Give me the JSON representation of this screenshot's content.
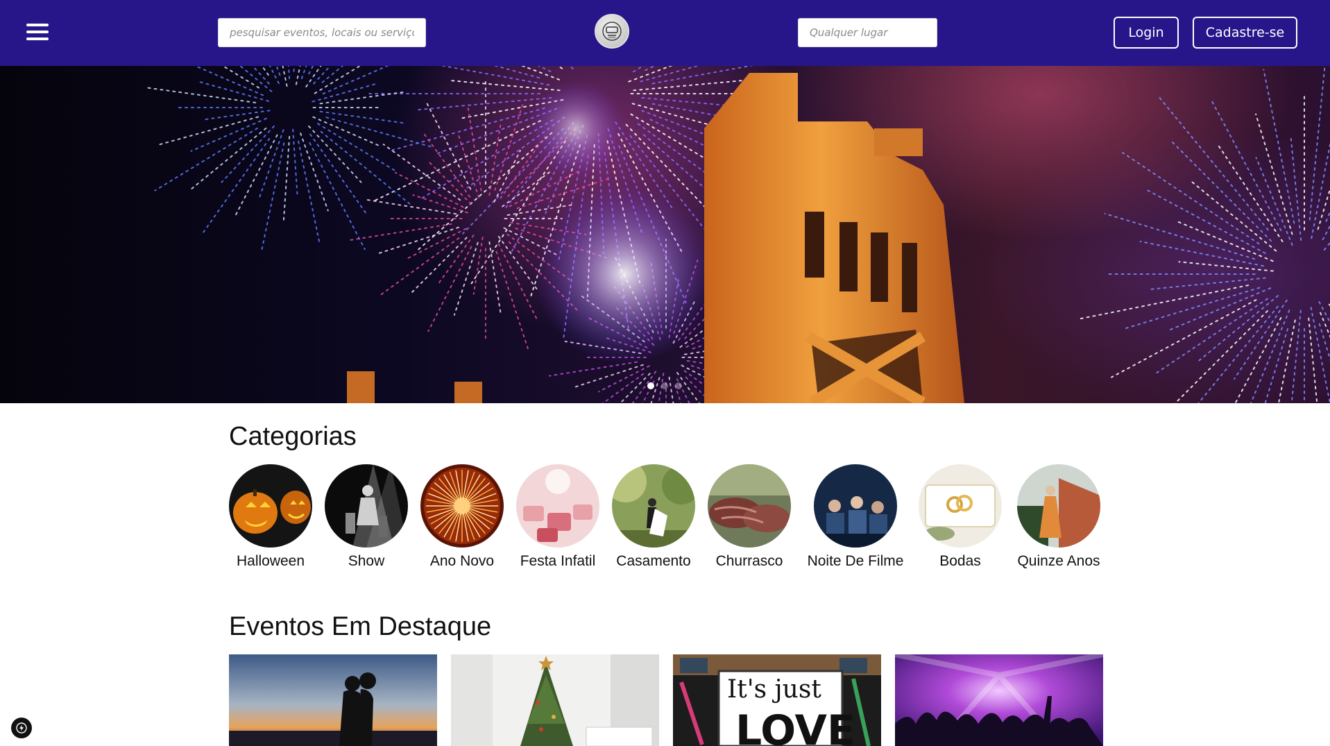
{
  "header": {
    "search_placeholder": "pesquisar eventos, locais ou serviços",
    "location_placeholder": "Qualquer lugar",
    "login_label": "Login",
    "signup_label": "Cadastre-se",
    "background_color": "#27168a"
  },
  "hero": {
    "active_slide": 1,
    "slide_count": 3
  },
  "categories": {
    "title": "Categorias",
    "items": [
      {
        "label": "Halloween"
      },
      {
        "label": "Show"
      },
      {
        "label": "Ano Novo"
      },
      {
        "label": "Festa Infatil"
      },
      {
        "label": "Casamento"
      },
      {
        "label": "Churrasco"
      },
      {
        "label": "Noite De Filme"
      },
      {
        "label": "Bodas"
      },
      {
        "label": "Quinze Anos"
      }
    ]
  },
  "featured": {
    "title": "Eventos Em Destaque",
    "cards": [
      {
        "image": "couple-sunset"
      },
      {
        "image": "christmas-tree"
      },
      {
        "image": "pride-love-sign",
        "sign_text": "It's just LOVE"
      },
      {
        "image": "concert-crowd"
      }
    ]
  }
}
